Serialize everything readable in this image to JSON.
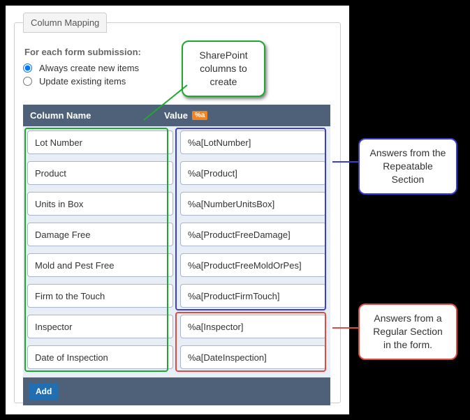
{
  "legend": "Column Mapping",
  "intro": "For each form submission:",
  "radios": {
    "create_label": "Always create new items",
    "update_label": "Update existing items"
  },
  "headers": {
    "colname": "Column Name",
    "colval": "Value",
    "badge": "%a"
  },
  "rows": [
    {
      "name": "Lot Number",
      "value": "%a[LotNumber]"
    },
    {
      "name": "Product",
      "value": "%a[Product]"
    },
    {
      "name": "Units in Box",
      "value": "%a[NumberUnitsBox]"
    },
    {
      "name": "Damage Free",
      "value": "%a[ProductFreeDamage]"
    },
    {
      "name": "Mold and Pest Free",
      "value": "%a[ProductFreeMoldOrPes]"
    },
    {
      "name": "Firm to the Touch",
      "value": "%a[ProductFirmTouch]"
    },
    {
      "name": "Inspector",
      "value": "%a[Inspector]"
    },
    {
      "name": "Date of Inspection",
      "value": "%a[DateInspection]"
    }
  ],
  "add_label": "Add",
  "callouts": {
    "green": "SharePoint columns to create",
    "blue": "Answers from the Repeatable Section",
    "red": "Answers from a Regular Section in the form."
  }
}
